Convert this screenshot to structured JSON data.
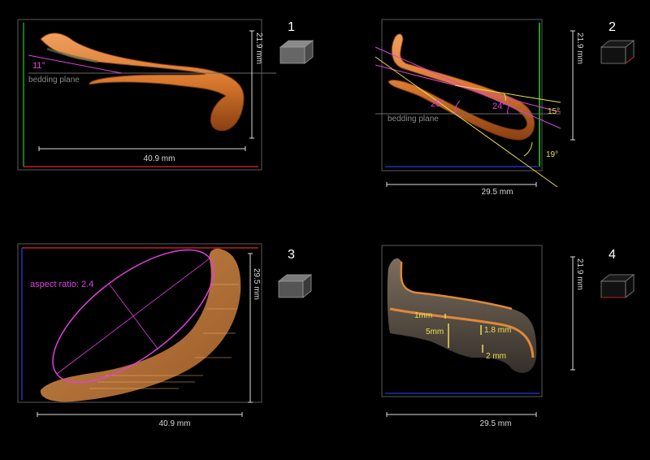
{
  "panels": [
    {
      "number": "1",
      "height_label": "21.9 mm",
      "width_label": "40.9 mm",
      "plane_label": "bedding plane",
      "angle_label": "11°"
    },
    {
      "number": "2",
      "height_label": "21.9 mm",
      "width_label": "29.5 mm",
      "plane_label": "bedding plane",
      "angles": {
        "a25": "25°",
        "a24": "24°",
        "a15": "15°",
        "a19": "19°"
      }
    },
    {
      "number": "3",
      "height_label": "29.5 mm",
      "width_label": "40.9 mm",
      "aspect_label": "aspect ratio: 2.4"
    },
    {
      "number": "4",
      "height_label": "21.9 mm",
      "width_label": "29.5 mm",
      "measures": {
        "m1": "1mm",
        "m5": "5mm",
        "m18": "1.8 mm",
        "m2": "2 mm"
      }
    }
  ],
  "colors": {
    "specimen": "#d8782e",
    "specimen_dark": "#8a3f12",
    "magenta": "#e040e0",
    "yellow": "#e8e04a",
    "frame": "#5a5a5a",
    "axis_red": "#c02020",
    "axis_green": "#20a020",
    "axis_blue": "#2030c0"
  }
}
